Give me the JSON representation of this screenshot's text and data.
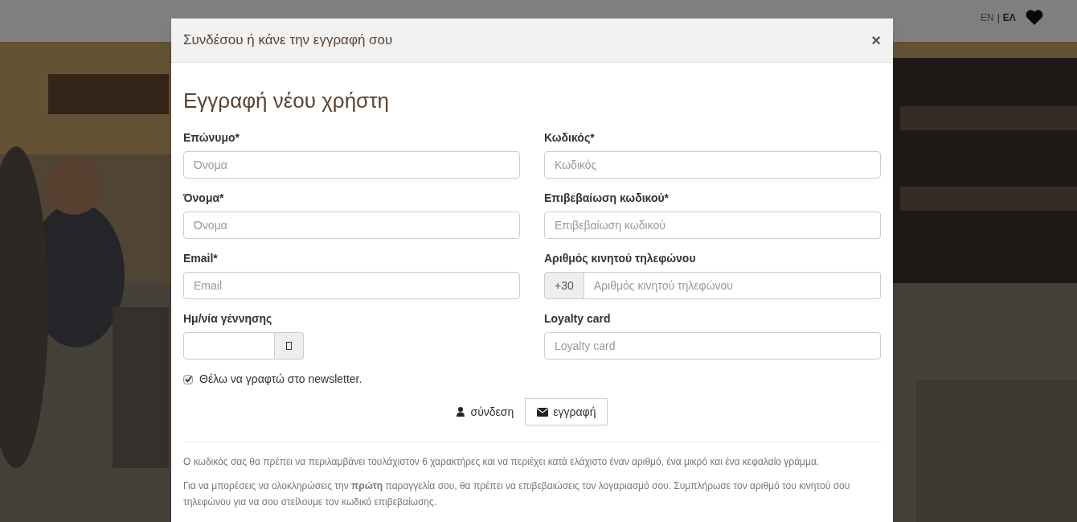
{
  "site_header": {
    "languages": [
      {
        "label": "EN",
        "selected": false
      },
      {
        "label": "ΕΛ",
        "selected": true
      }
    ],
    "separator": "|"
  },
  "modal": {
    "title": "Συνδέσου ή κάνε την εγγραφή σου",
    "close": "×",
    "heading": "Εγγραφή νέου χρήστη",
    "left_fields": [
      {
        "kind": "text",
        "label": "Επώνυμο*",
        "placeholder": "Όνομα"
      },
      {
        "kind": "text",
        "label": "Όνομα*",
        "placeholder": "Όνομα"
      },
      {
        "kind": "text",
        "label": "Email*",
        "placeholder": "Email"
      },
      {
        "kind": "date",
        "label": "Ημ/νία γέννησης"
      }
    ],
    "right_fields": [
      {
        "kind": "text",
        "label": "Κωδικός*",
        "placeholder": "Κωδικός"
      },
      {
        "kind": "text",
        "label": "Επιβεβαίωση κωδικού*",
        "placeholder": "Επιβεβαίωση κωδικού"
      },
      {
        "kind": "phone",
        "label": "Αριθμός κινητού τηλεφώνου",
        "prefix": "+30",
        "placeholder": "Αριθμός κινητού τηλεφώνου"
      },
      {
        "kind": "text",
        "label": "Loyalty card",
        "placeholder": "Loyalty card"
      }
    ],
    "newsletter": {
      "label": "Θέλω να γραφτώ στο newsletter.",
      "checked": true
    },
    "login_link": "σύνδεση",
    "register_button": "εγγραφή",
    "notes": [
      "Ο κωδικός σας θα πρέπει να περιλαμβάνει τουλάχιστον 6 χαρακτήρες και να περιέχει κατά ελάχιστο έναν αριθμό, ένα μικρό και ένα κεφαλαίο γράμμα.",
      "Για να μπορέσεις να ολοκληρώσεις την **πρώτη** παραγγελία σου, θα πρέπει να επιβεβαιώσεις τον λογαριασμό σου. Συμπλήρωσε τον αριθμό του κινητού σου τηλεφώνου για να σου στείλουμε τον κωδικό επιβεβαίωσης."
    ]
  }
}
